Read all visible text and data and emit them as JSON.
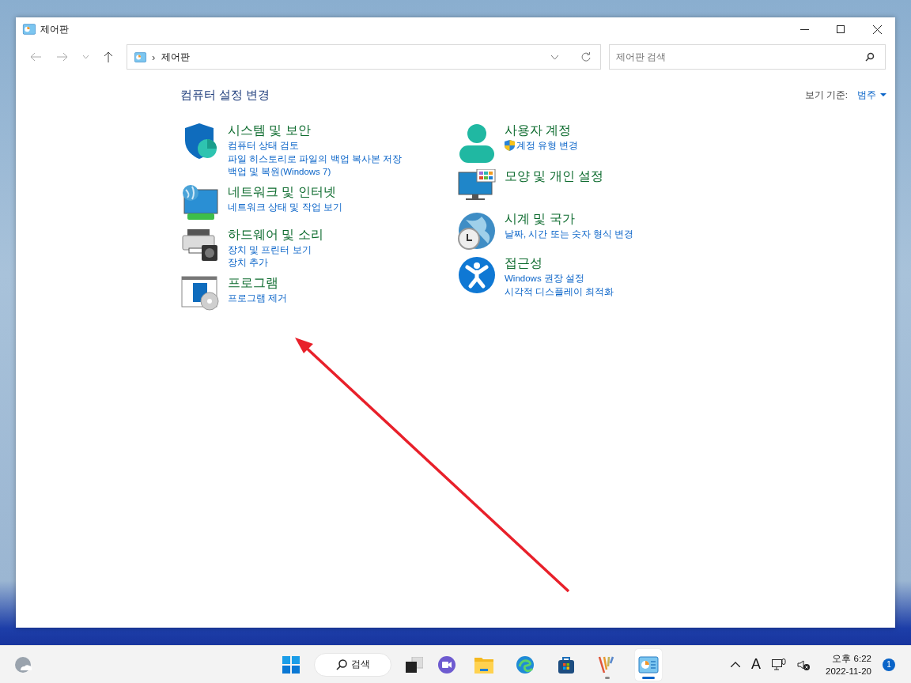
{
  "window": {
    "title": "제어판"
  },
  "address_bar": {
    "path": "제어판",
    "separator": "›"
  },
  "search": {
    "placeholder": "제어판 검색"
  },
  "heading": "컴퓨터 설정 변경",
  "view_by": {
    "label": "보기 기준:",
    "value": "범주"
  },
  "columns": [
    {
      "categories": [
        {
          "kind": "security",
          "title": "시스템 및 보안",
          "links": [
            {
              "text": "컴퓨터 상태 검토",
              "shield": false
            },
            {
              "text": "파일 히스토리로 파일의 백업 복사본 저장",
              "shield": false
            },
            {
              "text": "백업 및 복원(Windows 7)",
              "shield": false
            }
          ]
        },
        {
          "kind": "network",
          "title": "네트워크 및 인터넷",
          "links": [
            {
              "text": "네트워크 상태 및 작업 보기",
              "shield": false
            }
          ]
        },
        {
          "kind": "hardware",
          "title": "하드웨어 및 소리",
          "links": [
            {
              "text": "장치 및 프린터 보기",
              "shield": false
            },
            {
              "text": "장치 추가",
              "shield": false
            }
          ]
        },
        {
          "kind": "programs",
          "title": "프로그램",
          "links": [
            {
              "text": "프로그램 제거",
              "shield": false
            }
          ]
        }
      ]
    },
    {
      "categories": [
        {
          "kind": "user",
          "title": "사용자 계정",
          "links": [
            {
              "text": "계정 유형 변경",
              "shield": true
            }
          ]
        },
        {
          "kind": "appearance",
          "title": "모양 및 개인 설정"
        },
        {
          "kind": "clock",
          "title": "시계 및 국가",
          "links": [
            {
              "text": "날짜, 시간 또는 숫자 형식 변경",
              "shield": false
            }
          ]
        },
        {
          "kind": "accessibility",
          "title": "접근성",
          "links": [
            {
              "text": "Windows 권장 설정",
              "shield": false
            },
            {
              "text": "시각적 디스플레이 최적화",
              "shield": false
            }
          ]
        }
      ]
    }
  ],
  "taskbar": {
    "search": "검색",
    "apps": [
      {
        "kind": "explorer",
        "running": false,
        "selected": false
      },
      {
        "kind": "edge",
        "running": false,
        "selected": false
      },
      {
        "kind": "store",
        "running": false,
        "selected": false
      },
      {
        "kind": "paint",
        "running": true,
        "selected": false
      },
      {
        "kind": "controlpanel",
        "running": true,
        "selected": true
      }
    ],
    "ime": "A",
    "time": "오후 6:22",
    "date": "2022-11-20",
    "notifications": "1"
  }
}
